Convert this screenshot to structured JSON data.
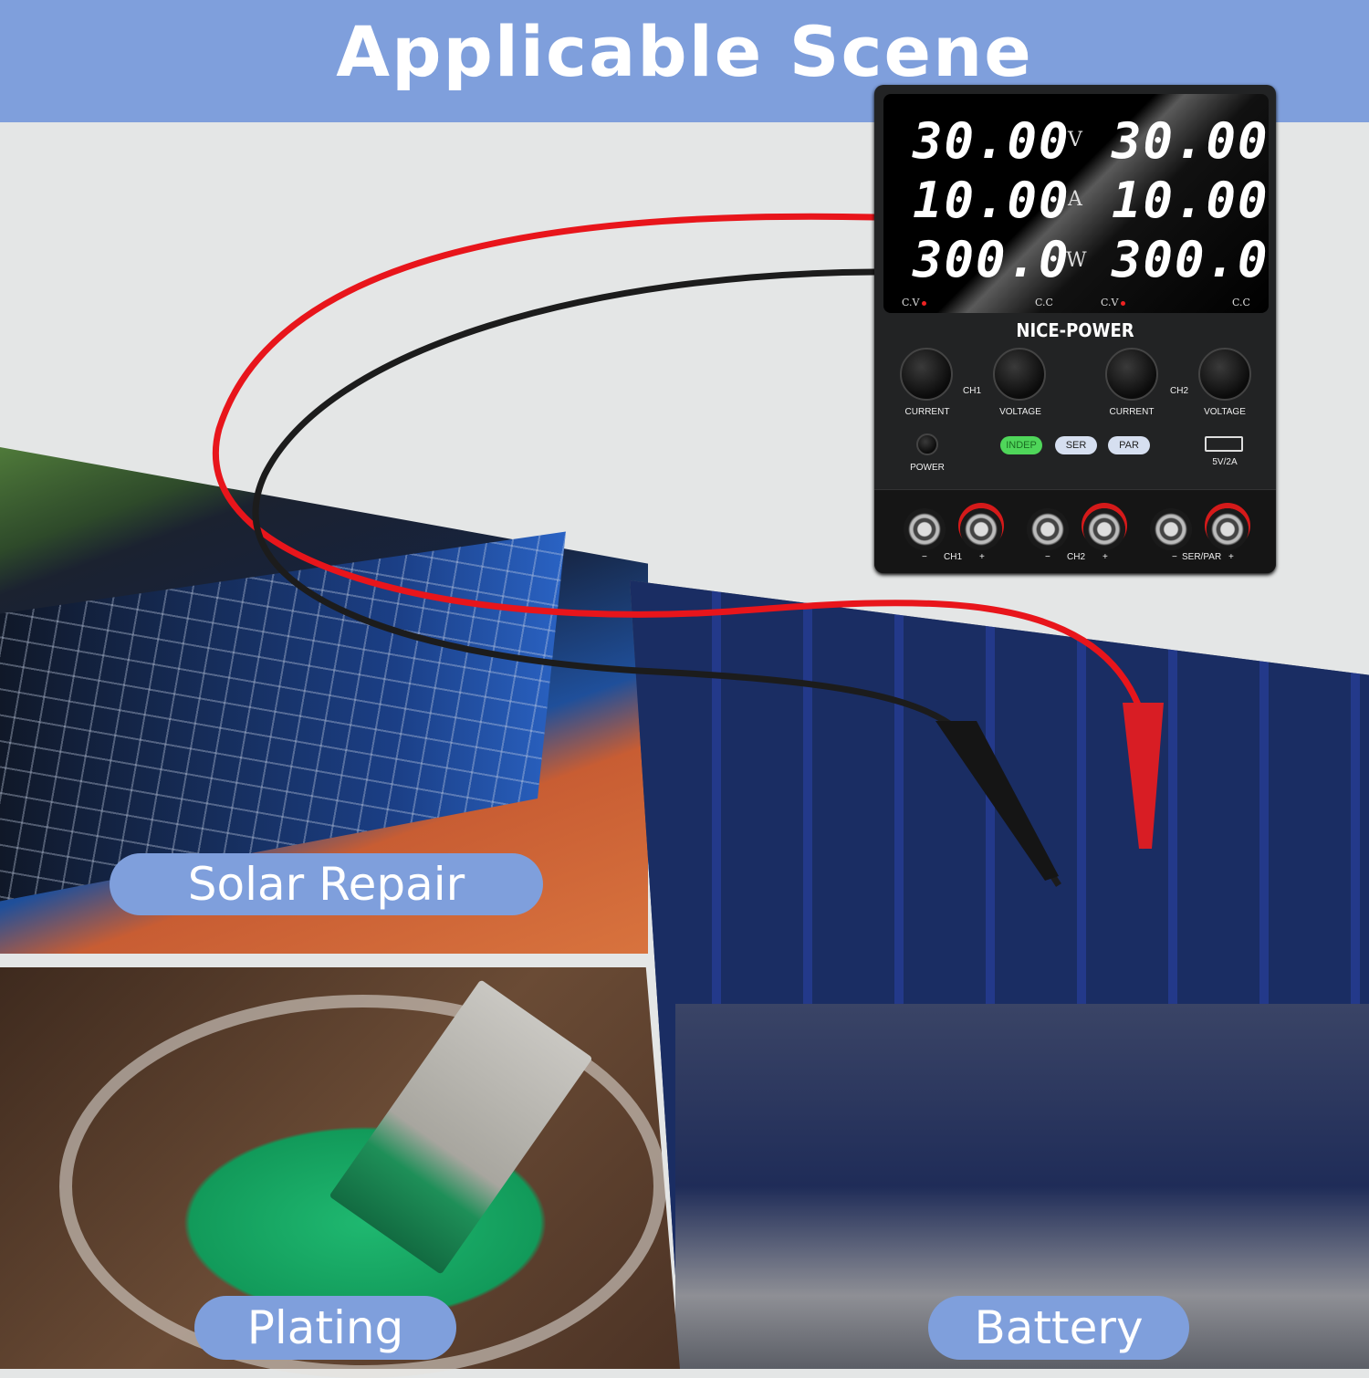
{
  "header": {
    "title": "Applicable Scene",
    "color": "#7f9fdc"
  },
  "scenes": [
    {
      "label": "Solar Repair"
    },
    {
      "label": "Plating"
    },
    {
      "label": "Battery"
    }
  ],
  "power_supply": {
    "brand": "NICE-POWER",
    "ch1": {
      "voltage": "30.00",
      "current": "10.00",
      "power": "300.0"
    },
    "ch2": {
      "voltage": "30.00",
      "current": "10.00",
      "power": "300.0"
    },
    "units": {
      "v": "V",
      "a": "A",
      "w": "W"
    },
    "indicators": {
      "cv": "C.V",
      "cc": "C.C"
    },
    "knobs": {
      "current": "CURRENT",
      "voltage": "VOLTAGE",
      "ch1": "CH1",
      "ch2": "CH2"
    },
    "power_label": "POWER",
    "modes": [
      {
        "label": "INDEP",
        "active": true
      },
      {
        "label": "SER",
        "active": false
      },
      {
        "label": "PAR",
        "active": false
      }
    ],
    "usb": "5V/2A",
    "terminals": {
      "minus": "−",
      "plus": "+",
      "ch1": "CH1",
      "ch2": "CH2",
      "serpar": "SER/PAR"
    }
  }
}
